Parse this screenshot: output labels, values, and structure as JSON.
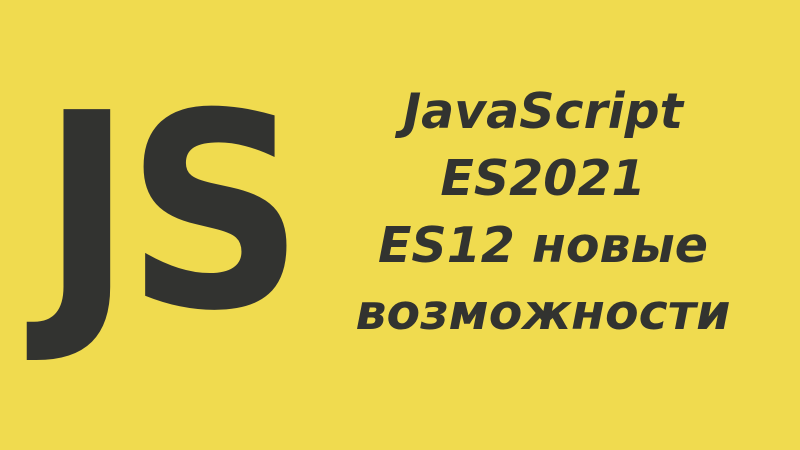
{
  "background_color": "#f0db4f",
  "text_color": "#323330",
  "logo": {
    "text": "JS"
  },
  "headline": {
    "lines": [
      "JavaScript",
      "ES2021",
      "ES12 новые",
      "возможности"
    ]
  }
}
